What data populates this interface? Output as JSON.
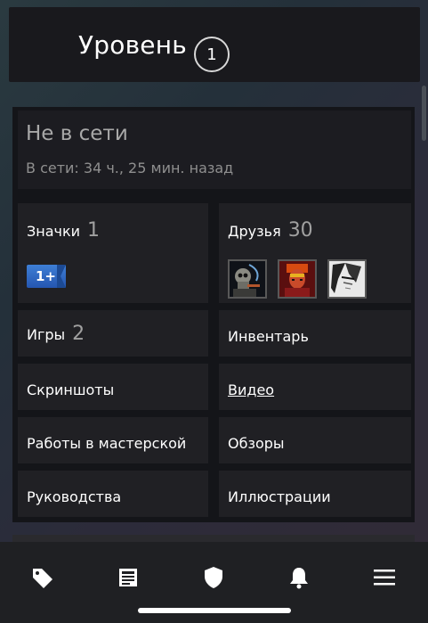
{
  "header": {
    "level_label": "Уровень",
    "level_value": "1"
  },
  "status": {
    "title": "Не в сети",
    "subtitle": "В сети: 34 ч., 25 мин. назад"
  },
  "sections": {
    "badges": {
      "label": "Значки",
      "count": "1",
      "badge_text": "1+"
    },
    "friends": {
      "label": "Друзья",
      "count": "30"
    },
    "games": {
      "label": "Игры",
      "count": "2"
    },
    "inventory": {
      "label": "Инвентарь"
    },
    "screenshots": {
      "label": "Скриншоты"
    },
    "videos": {
      "label": "Видео"
    },
    "workshop": {
      "label": "Работы в мастерской"
    },
    "reviews": {
      "label": "Обзоры"
    },
    "guides": {
      "label": "Руководства"
    },
    "artwork": {
      "label": "Иллюстрации"
    }
  },
  "tabbar": {
    "items": [
      {
        "icon": "tag-icon"
      },
      {
        "icon": "news-icon"
      },
      {
        "icon": "shield-icon"
      },
      {
        "icon": "bell-icon"
      },
      {
        "icon": "menu-icon"
      }
    ]
  },
  "colors": {
    "card_bg": "#202024",
    "panel_bg": "#141519",
    "badge_blue": "#2f6bc4",
    "tabbar_bg": "#1f2023"
  }
}
